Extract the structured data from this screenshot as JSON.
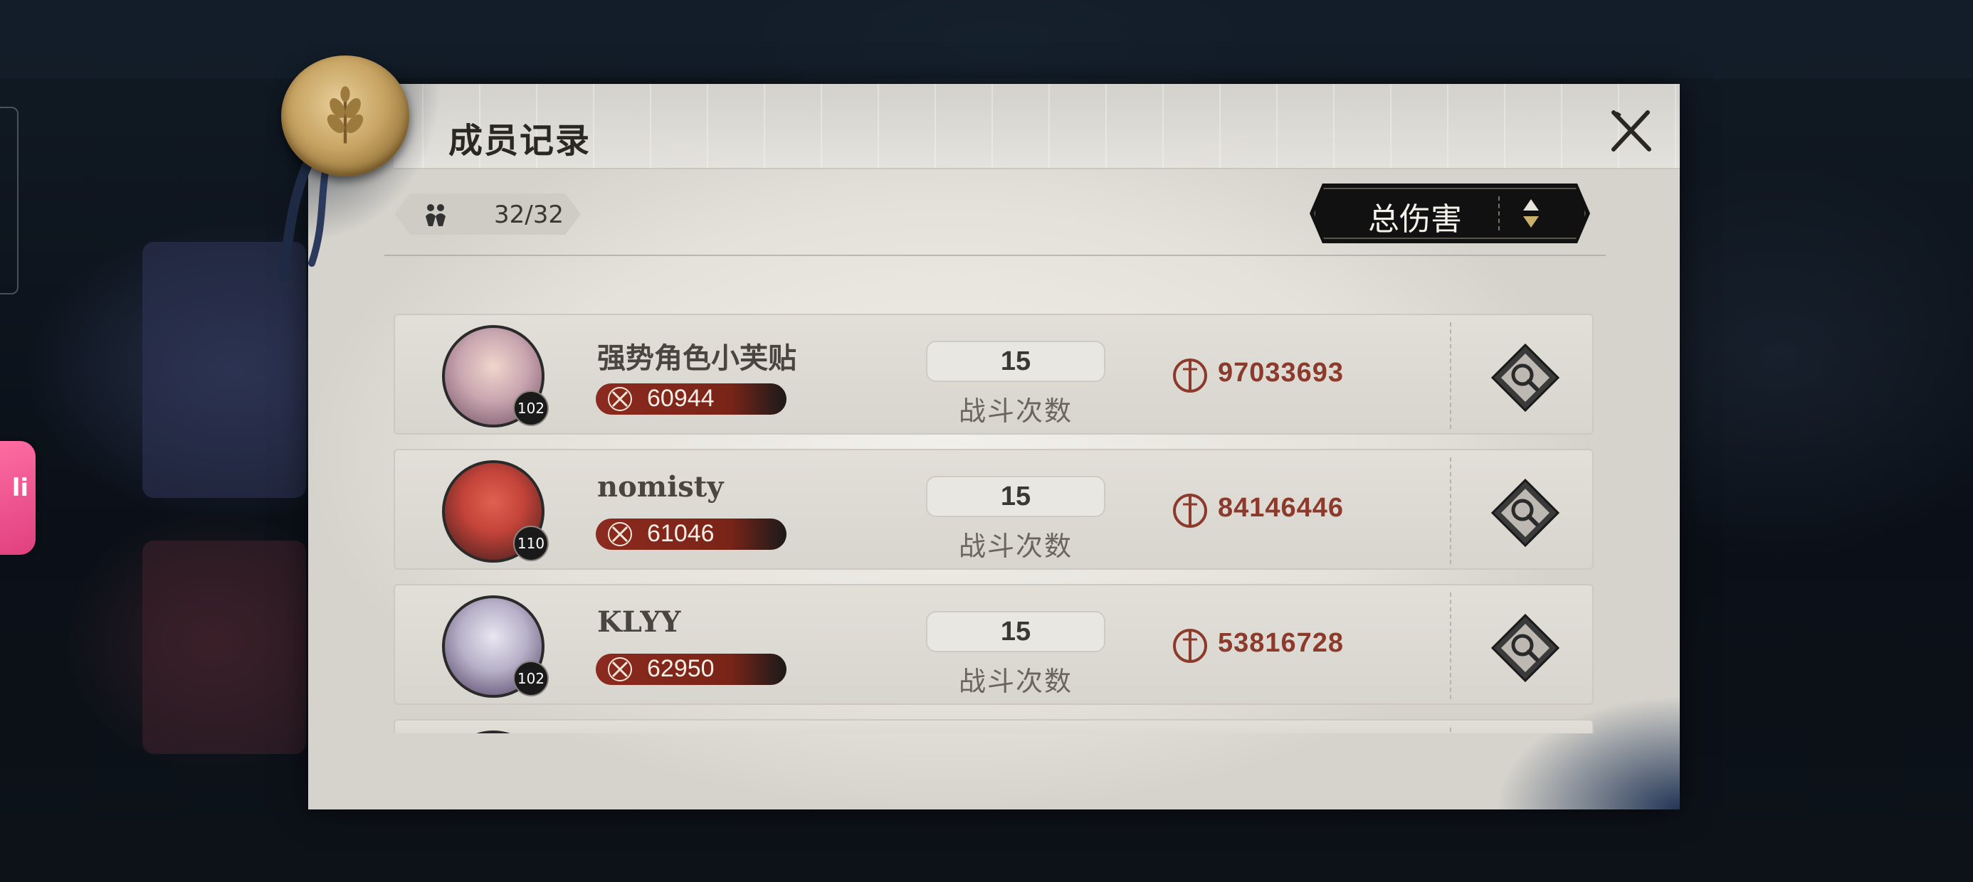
{
  "dialog": {
    "title": "成员记录",
    "member_count": "32/32",
    "sort": {
      "label": "总伤害"
    }
  },
  "members": [
    {
      "name": "强势角色小芙贴",
      "level": "102",
      "power": "60944",
      "battles": "15",
      "battles_label": "战斗次数",
      "damage": "97033693",
      "avatar_theme": "pink-haired maid",
      "avatar_color": "#c9a6b0"
    },
    {
      "name": "nomisty",
      "level": "110",
      "power": "61046",
      "battles": "15",
      "battles_label": "战斗次数",
      "damage": "84146446",
      "avatar_theme": "red bald figure",
      "avatar_color": "#c4443a"
    },
    {
      "name": "KLYY",
      "level": "102",
      "power": "62950",
      "battles": "15",
      "battles_label": "战斗次数",
      "damage": "53816728",
      "avatar_theme": "white-haired masked figure",
      "avatar_color": "#b7b0c8"
    }
  ],
  "colors": {
    "accent_red": "#8c3a2c",
    "power_bar": "#8c2a1f",
    "panel": "#e6e3dd"
  },
  "icons": {
    "close": "close-icon",
    "members": "members-icon",
    "sort": "sort-arrows-icon",
    "power": "crossed-swords-icon",
    "damage": "damage-emblem-icon",
    "inspect": "magnify-icon"
  }
}
